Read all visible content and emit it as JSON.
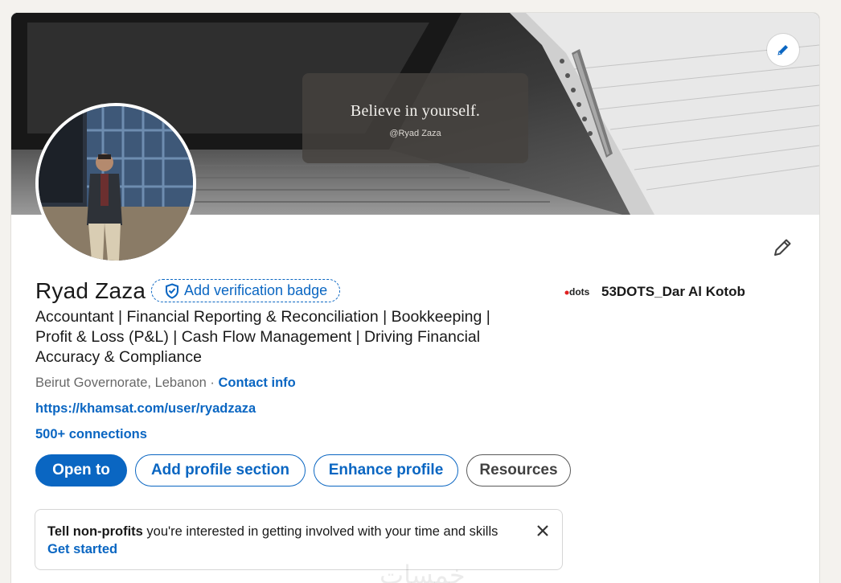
{
  "cover": {
    "quote_title": "Believe in yourself.",
    "quote_handle": "@Ryad Zaza"
  },
  "profile": {
    "name": "Ryad Zaza",
    "verification_badge": "Add verification badge",
    "headline": "Accountant | Financial Reporting & Reconciliation | Bookkeeping | Profit & Loss (P&L) | Cash Flow Management | Driving Financial Accuracy & Compliance",
    "location": "Beirut Governorate, Lebanon",
    "location_separator": " · ",
    "contact_info": "Contact info",
    "website": "https://khamsat.com/user/ryadzaza",
    "connections": "500+ connections"
  },
  "company": {
    "logo_text": "dots",
    "name": "53DOTS_Dar Al Kotob"
  },
  "actions": {
    "open_to": "Open to",
    "add_section": "Add profile section",
    "enhance": "Enhance profile",
    "resources": "Resources"
  },
  "prompt": {
    "bold": "Tell non-profits",
    "rest": " you're interested in getting involved with your time and skills",
    "link": "Get started"
  },
  "watermark": "خمسات",
  "colors": {
    "accent": "#0a66c2",
    "page_bg": "#f4f2ee"
  }
}
